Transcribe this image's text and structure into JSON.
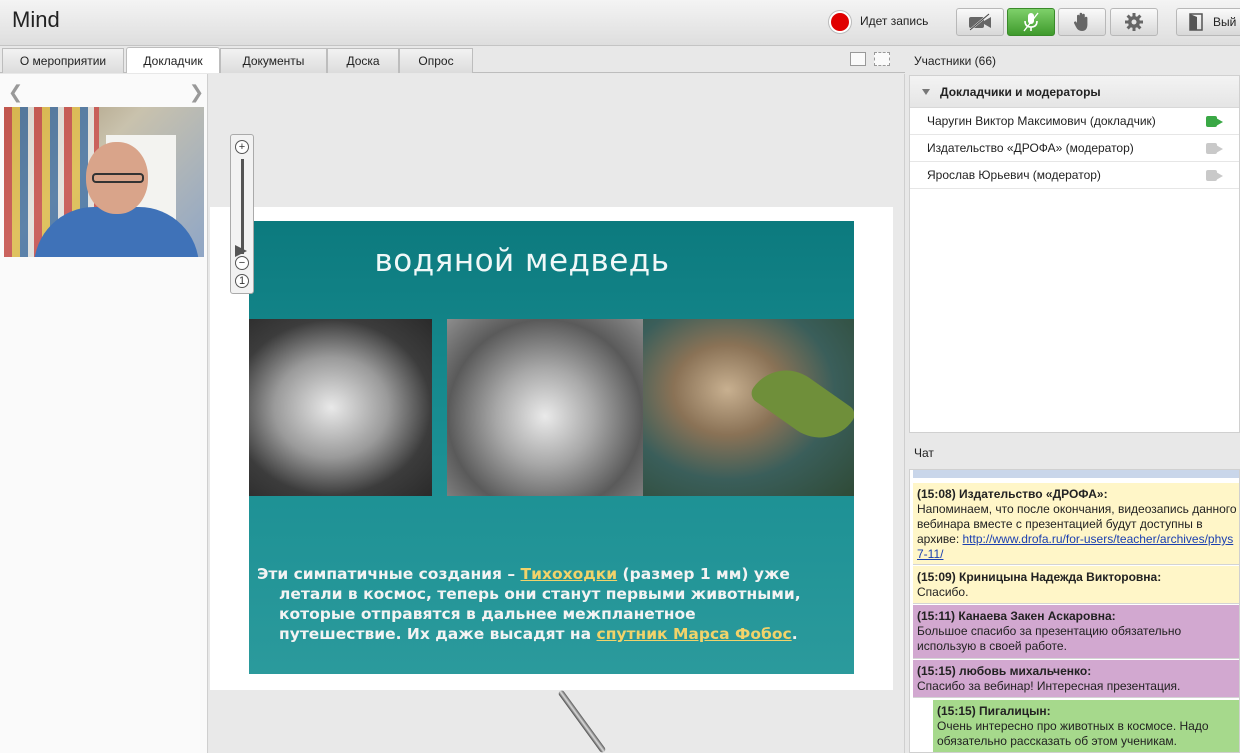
{
  "app": {
    "title": "Mind"
  },
  "recording": {
    "label": "Идет запись",
    "color": "#e00000"
  },
  "toolbar": {
    "buttons": [
      {
        "name": "camera-off-icon"
      },
      {
        "name": "microphone-icon"
      },
      {
        "name": "raise-hand-icon"
      },
      {
        "name": "gear-icon"
      }
    ],
    "exit_label": "Вый"
  },
  "tabs": [
    "О мероприятии",
    "Докладчик",
    "Документы",
    "Доска",
    "Опрос"
  ],
  "active_tab": "Докладчик",
  "slide": {
    "title": "водяной медведь",
    "text_before": "Эти симпатичные создания – ",
    "link1": "Тихоходки",
    "text_l1_after": " (размер 1 мм) уже",
    "line2": "летали в космос, теперь они станут первыми животными,",
    "line3": "которые отправятся в дальнее межпланетное",
    "line4_before": "путешествие. Их даже высадят на ",
    "link2": "спутник Марса Фобос",
    "line4_after": "."
  },
  "participants": {
    "header": "Участники (66)",
    "group": "Докладчики и модераторы",
    "list": [
      {
        "name": "Чаругин Виктор Максимович (докладчик)",
        "camera": "active"
      },
      {
        "name": "Издательство «ДРОФА» (модератор)",
        "camera": "inactive"
      },
      {
        "name": "Ярослав Юрьевич (модератор)",
        "camera": "inactive"
      }
    ]
  },
  "chat": {
    "header": "Чат",
    "messages": [
      {
        "time": "(15:08)",
        "author": "Издательство «ДРОФА»:",
        "text": "Напоминаем, что после окончания, видеозапись данного вебинара вместе с презентацией будут доступны в архиве: ",
        "link": "http://www.drofa.ru/for-users/teacher/archives/phys7-11/",
        "color": "yellow"
      },
      {
        "time": "(15:09)",
        "author": "Криницына Надежда Викторовна:",
        "text": "Спасибо.",
        "color": "yellow"
      },
      {
        "time": "(15:11)",
        "author": "Канаева Закен Аскаровна:",
        "text": "Большое спасибо за презентацию обязательно использую в своей работе.",
        "color": "purple"
      },
      {
        "time": "(15:15)",
        "author": "любовь михальченко:",
        "text": "Спасибо за вебинар! Интересная презентация.",
        "color": "purple"
      },
      {
        "time": "(15:15)",
        "author": "Пигалицын:",
        "text": "Очень интересно про животных в космосе. Надо обязательно рассказать об этом ученикам.",
        "color": "green"
      }
    ]
  }
}
